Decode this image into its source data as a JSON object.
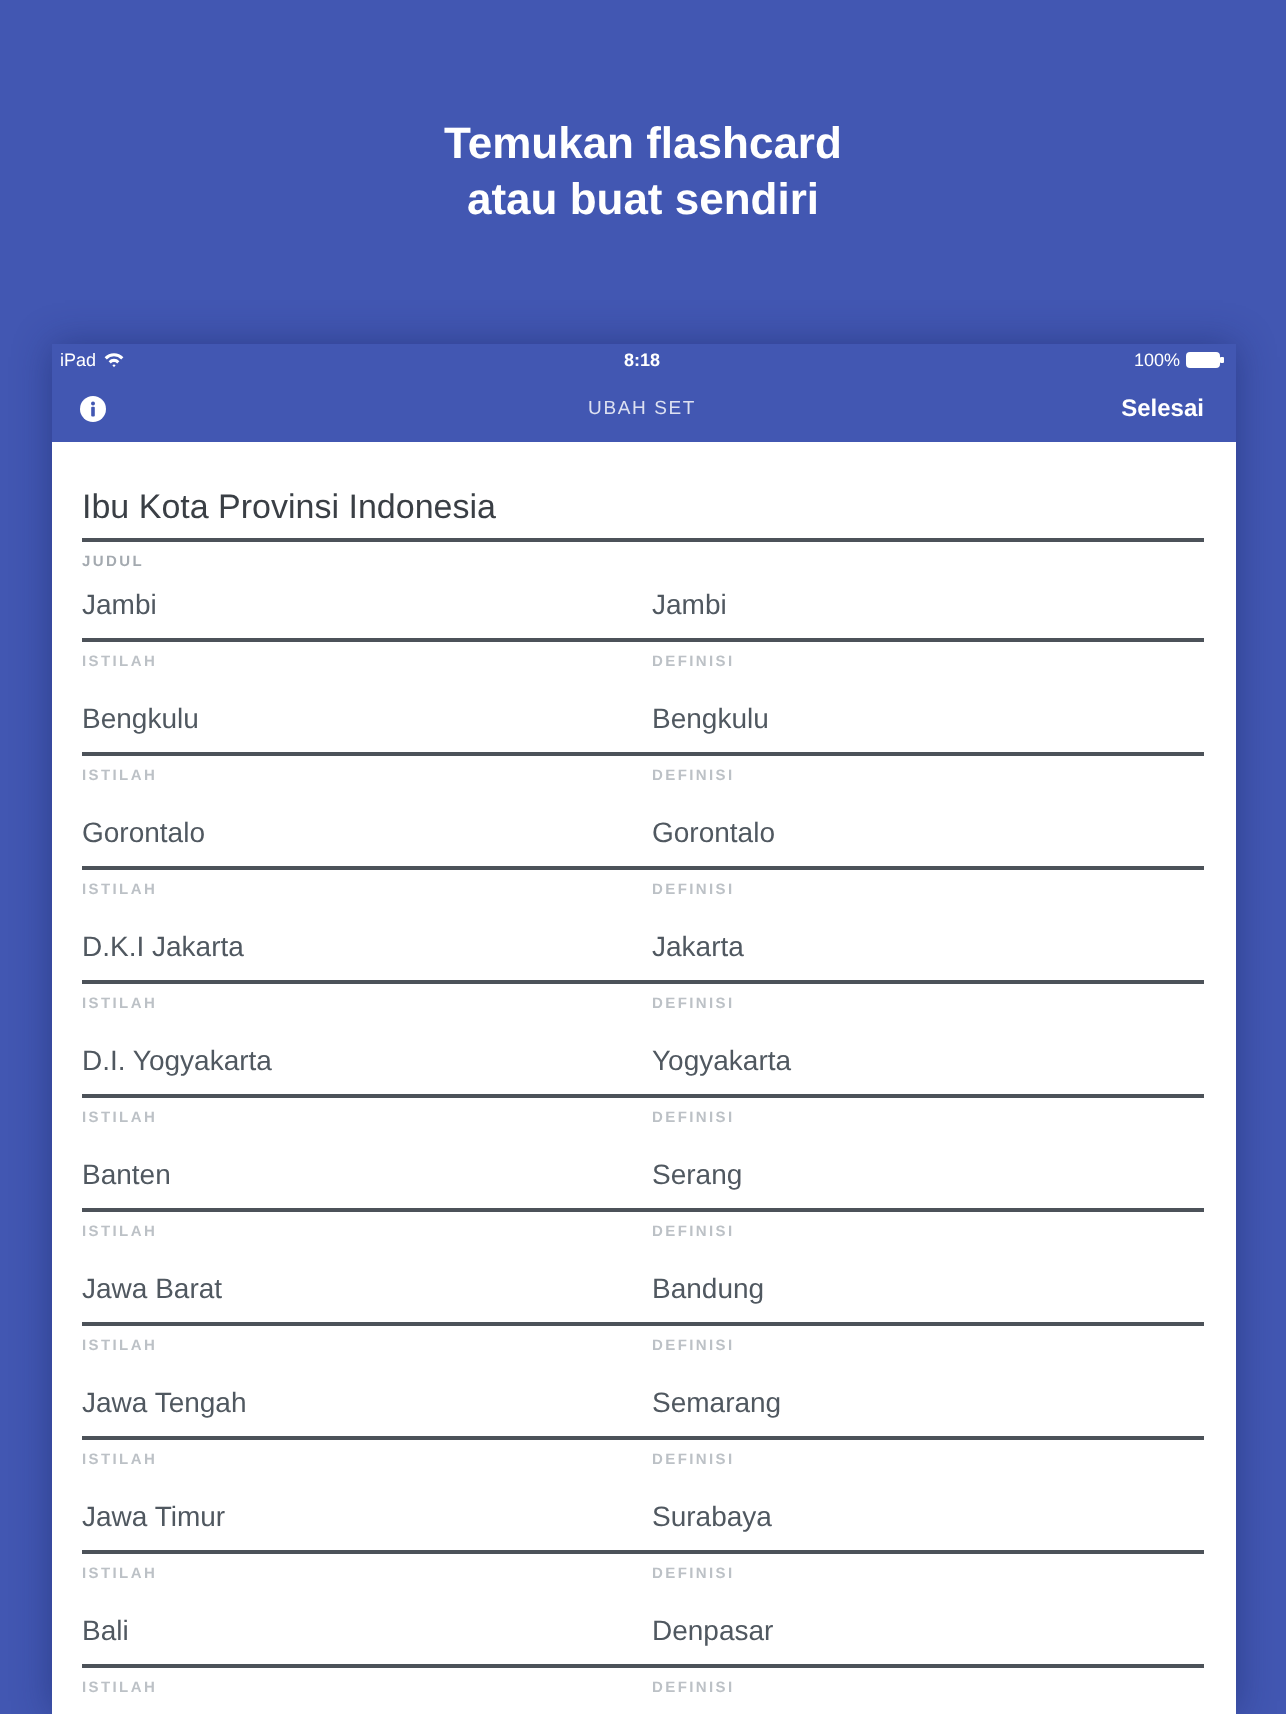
{
  "headline": [
    "Temukan flashcard",
    "atau buat sendiri"
  ],
  "status_bar": {
    "device": "iPad",
    "time": "8:18",
    "battery": "100%"
  },
  "nav_bar": {
    "title": "UBAH SET",
    "done": "Selesai"
  },
  "set": {
    "title": "Ibu Kota Provinsi Indonesia",
    "title_label": "JUDUL",
    "cards": [
      {
        "term": "Jambi",
        "definition": "Jambi",
        "term_label": "ISTILAH",
        "definition_label": "DEFINISI"
      },
      {
        "term": "Bengkulu",
        "definition": "Bengkulu",
        "term_label": "ISTILAH",
        "definition_label": "DEFINISI"
      },
      {
        "term": "Gorontalo",
        "definition": "Gorontalo",
        "term_label": "ISTILAH",
        "definition_label": "DEFINISI"
      },
      {
        "term": "D.K.I Jakarta",
        "definition": "Jakarta",
        "term_label": "ISTILAH",
        "definition_label": "DEFINISI"
      },
      {
        "term": "D.I. Yogyakarta",
        "definition": "Yogyakarta",
        "term_label": "ISTILAH",
        "definition_label": "DEFINISI"
      },
      {
        "term": "Banten",
        "definition": "Serang",
        "term_label": "ISTILAH",
        "definition_label": "DEFINISI"
      },
      {
        "term": "Jawa Barat",
        "definition": "Bandung",
        "term_label": "ISTILAH",
        "definition_label": "DEFINISI"
      },
      {
        "term": "Jawa Tengah",
        "definition": "Semarang",
        "term_label": "ISTILAH",
        "definition_label": "DEFINISI"
      },
      {
        "term": "Jawa Timur",
        "definition": "Surabaya",
        "term_label": "ISTILAH",
        "definition_label": "DEFINISI"
      },
      {
        "term": "Bali",
        "definition": "Denpasar",
        "term_label": "ISTILAH",
        "definition_label": "DEFINISI"
      }
    ]
  }
}
